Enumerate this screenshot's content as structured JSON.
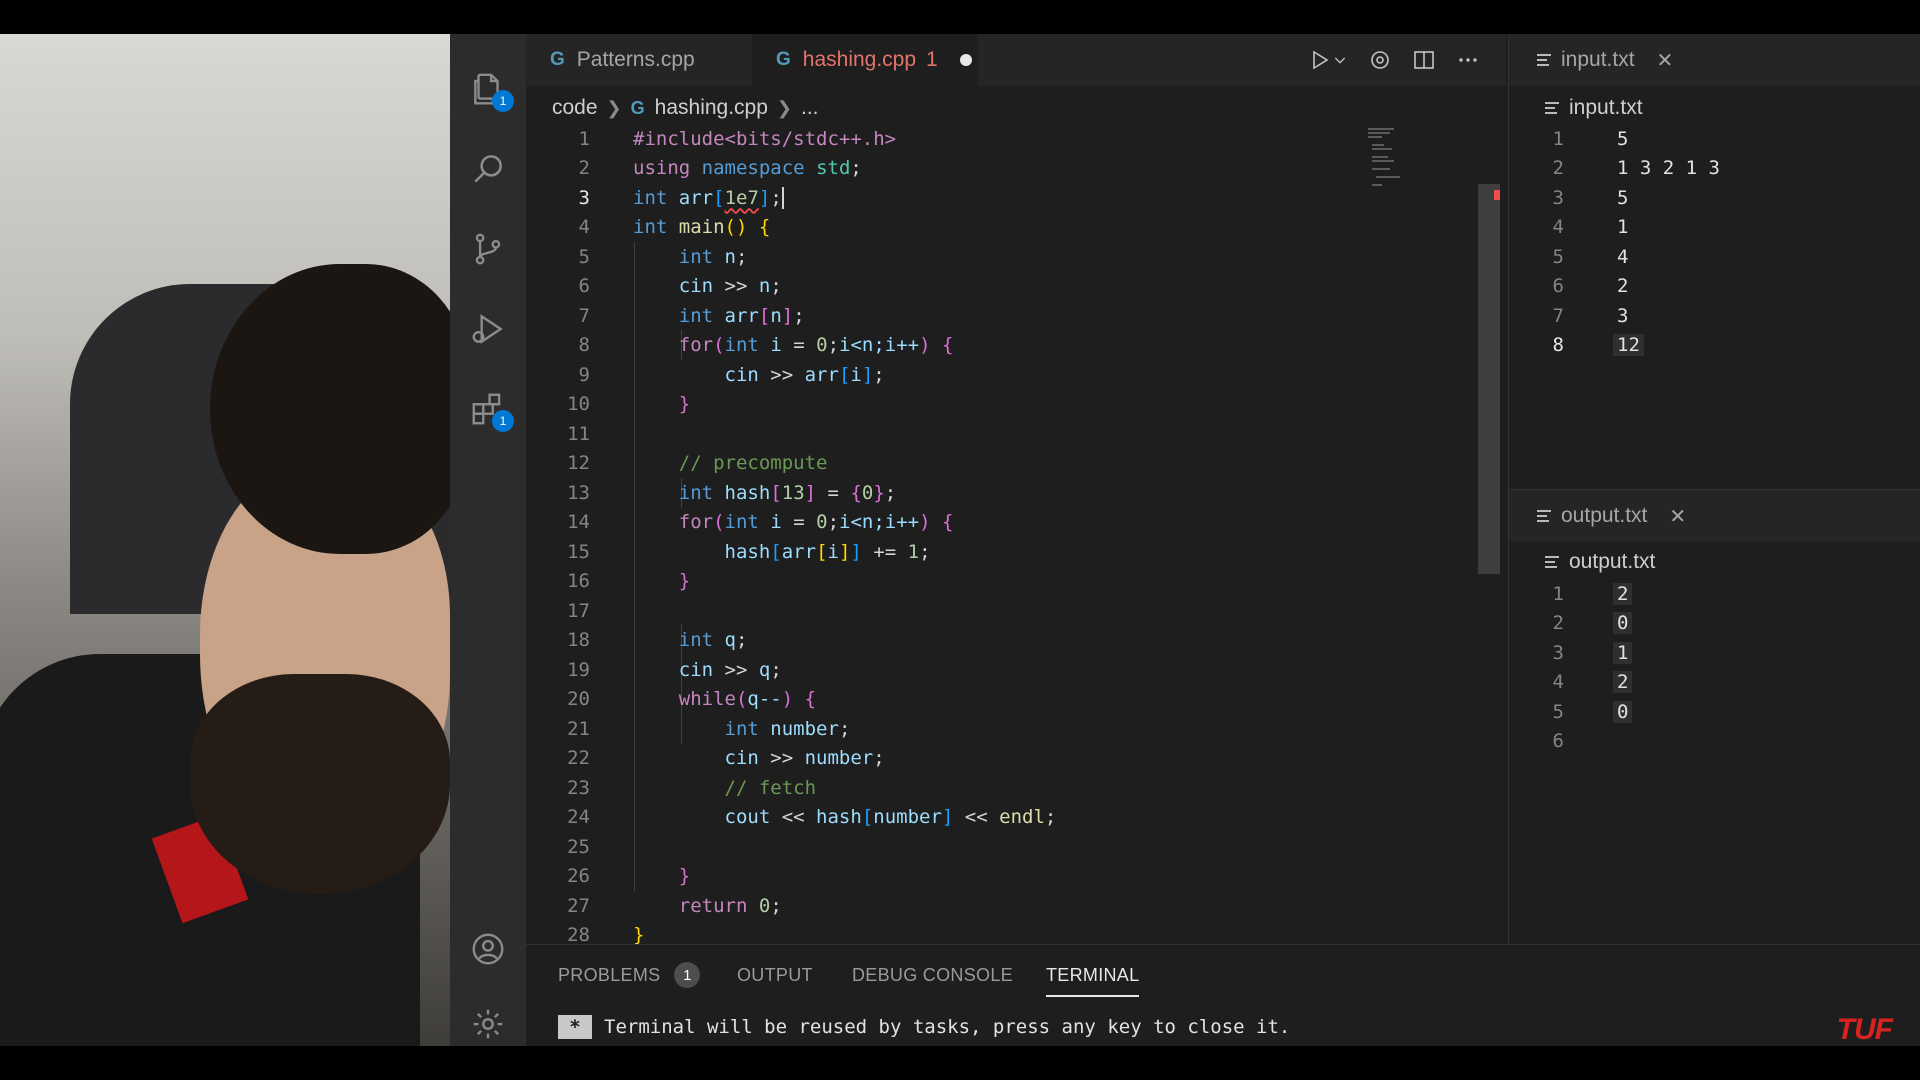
{
  "activity_bar": {
    "explorer_badge": "1",
    "extensions_badge": "1"
  },
  "tabs": [
    {
      "label": "Patterns.cpp"
    },
    {
      "label": "hashing.cpp",
      "problems": "1"
    }
  ],
  "breadcrumb": [
    "code",
    "hashing.cpp",
    "..."
  ],
  "code_lines": [
    {
      "n": "1"
    },
    {
      "n": "2"
    },
    {
      "n": "3"
    },
    {
      "n": "4"
    },
    {
      "n": "5"
    },
    {
      "n": "6"
    },
    {
      "n": "7"
    },
    {
      "n": "8"
    },
    {
      "n": "9"
    },
    {
      "n": "10"
    },
    {
      "n": "11"
    },
    {
      "n": "12"
    },
    {
      "n": "13"
    },
    {
      "n": "14"
    },
    {
      "n": "15"
    },
    {
      "n": "16"
    },
    {
      "n": "17"
    },
    {
      "n": "18"
    },
    {
      "n": "19"
    },
    {
      "n": "20"
    },
    {
      "n": "21"
    },
    {
      "n": "22"
    },
    {
      "n": "23"
    },
    {
      "n": "24"
    },
    {
      "n": "25"
    },
    {
      "n": "26"
    },
    {
      "n": "27"
    },
    {
      "n": "28"
    }
  ],
  "code": {
    "l1": "#include<bits/stdc++.h>",
    "l2a": "using",
    "l2b": "namespace",
    "l2c": "std",
    "l3a": "int",
    "l3b": "arr",
    "l3c": "1e7",
    "l4a": "int",
    "l4b": "main",
    "l5a": "int",
    "l5b": "n",
    "l6a": "cin",
    "l6b": "n",
    "l7a": "int",
    "l7b": "arr",
    "l7c": "n",
    "l8a": "for",
    "l8b": "int",
    "l8c": "i",
    "l8d": "0",
    "l8e": "i<n;i++",
    "l9a": "cin",
    "l9b": "arr",
    "l9c": "i",
    "l12": "// precompute",
    "l13a": "int",
    "l13b": "hash",
    "l13c": "13",
    "l13d": "0",
    "l14a": "for",
    "l14b": "int",
    "l14c": "i",
    "l14d": "0",
    "l14e": "i<n;i++",
    "l15a": "hash",
    "l15b": "arr",
    "l15c": "i",
    "l15d": "1",
    "l18a": "int",
    "l18b": "q",
    "l19a": "cin",
    "l19b": "q",
    "l20a": "while",
    "l20b": "q--",
    "l21a": "int",
    "l21b": "number",
    "l22a": "cin",
    "l22b": "number",
    "l23": "// fetch",
    "l24a": "cout",
    "l24b": "hash",
    "l24c": "number",
    "l24d": "endl",
    "l27a": "return",
    "l27b": "0"
  },
  "input_pane": {
    "tab_label": "input.txt",
    "breadcrumb": "input.txt",
    "lines": [
      {
        "n": "1",
        "v": "5"
      },
      {
        "n": "2",
        "v": "1 3 2 1 3"
      },
      {
        "n": "3",
        "v": "5"
      },
      {
        "n": "4",
        "v": "1"
      },
      {
        "n": "5",
        "v": "4"
      },
      {
        "n": "6",
        "v": "2"
      },
      {
        "n": "7",
        "v": "3"
      },
      {
        "n": "8",
        "v": "12"
      }
    ]
  },
  "output_pane": {
    "tab_label": "output.txt",
    "breadcrumb": "output.txt",
    "lines": [
      {
        "n": "1",
        "v": "2"
      },
      {
        "n": "2",
        "v": "0"
      },
      {
        "n": "3",
        "v": "1"
      },
      {
        "n": "4",
        "v": "2"
      },
      {
        "n": "5",
        "v": "0"
      },
      {
        "n": "6",
        "v": ""
      }
    ]
  },
  "panel": {
    "tabs": [
      {
        "label": "PROBLEMS",
        "badge": "1"
      },
      {
        "label": "OUTPUT"
      },
      {
        "label": "DEBUG CONSOLE"
      },
      {
        "label": "TERMINAL"
      }
    ],
    "terminal_message": "Terminal will be reused by tasks, press any key to close it."
  },
  "watermark": "TUF"
}
